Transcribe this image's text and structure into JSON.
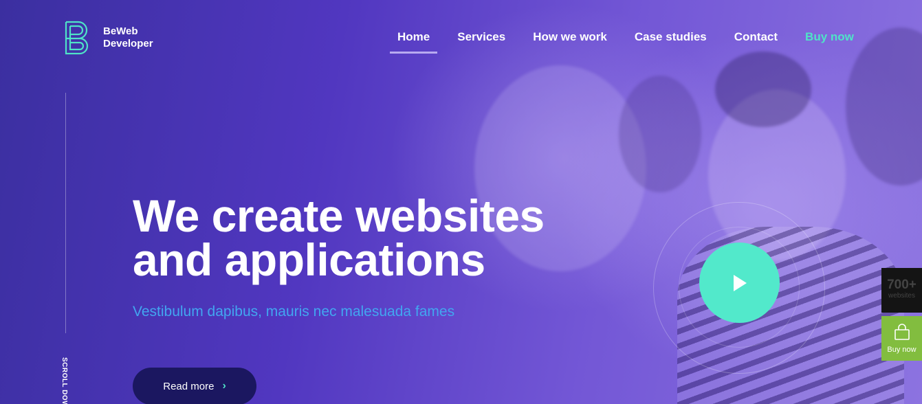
{
  "logo": {
    "line1": "BeWeb",
    "line2": "Developer",
    "icon": "b-logo-icon"
  },
  "nav": {
    "items": [
      {
        "label": "Home",
        "active": true
      },
      {
        "label": "Services"
      },
      {
        "label": "How we work"
      },
      {
        "label": "Case studies"
      },
      {
        "label": "Contact"
      },
      {
        "label": "Buy now",
        "accent": "#4fe3c7"
      }
    ]
  },
  "hero": {
    "headline_line1": "We create websites",
    "headline_line2": "and applications",
    "subtitle": "Vestibulum dapibus, mauris nec malesuada fames",
    "cta_label": "Read more",
    "cta_icon": "chevron-right-icon",
    "scroll_label": "SCROLL DOWN",
    "play_icon": "play-icon"
  },
  "side_widgets": {
    "stat_value": "700+",
    "stat_label": "websites",
    "buy_label": "Buy now",
    "buy_icon": "shopping-bag-icon"
  },
  "colors": {
    "accent_teal": "#52e9cb",
    "subtitle_blue": "#42a6f0",
    "button_navy": "#1b1760",
    "buy_green": "#82bd3f"
  }
}
